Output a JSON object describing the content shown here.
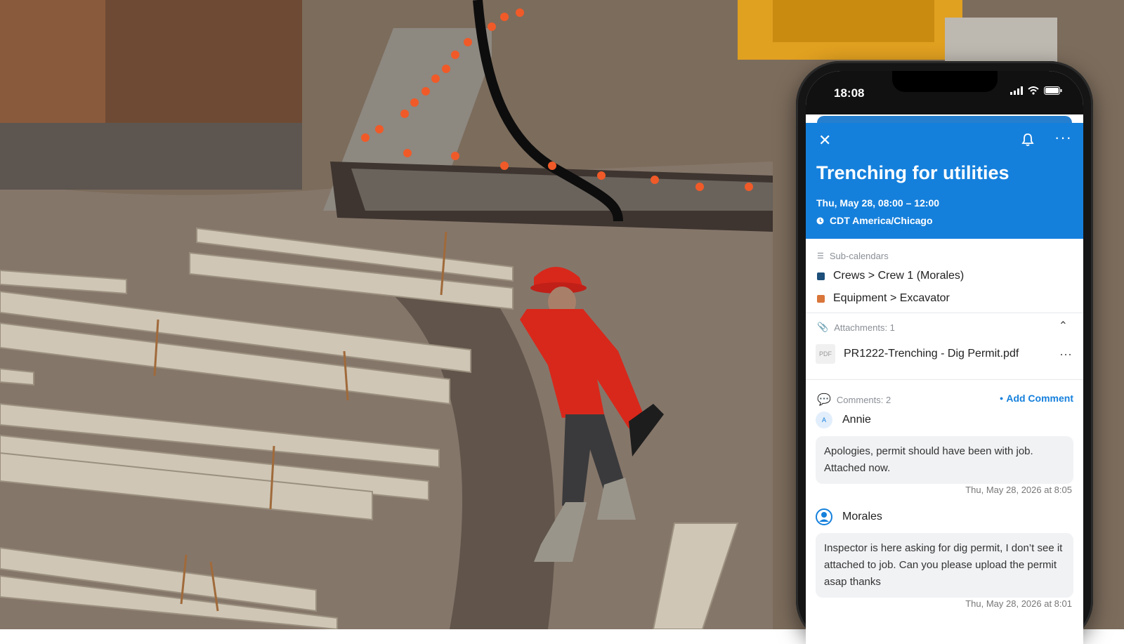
{
  "phone": {
    "status_time": "18:08",
    "header": {
      "title": "Trenching for utilities",
      "when": "Thu, May 28, 08:00 – 12:00",
      "timezone": "CDT America/Chicago",
      "close_icon": "close-icon",
      "bell_icon": "bell-icon",
      "more_icon": "more-icon"
    },
    "subcalendars": {
      "label": "Sub-calendars",
      "items": [
        {
          "label": "Crews > Crew 1 (Morales)",
          "color": "#1d4f7a"
        },
        {
          "label": "Equipment > Excavator",
          "color": "#d9763a"
        }
      ]
    },
    "attachments": {
      "label": "Attachments: 1",
      "files": [
        {
          "badge": "PDF",
          "name": "PR1222-Trenching - Dig Permit.pdf"
        }
      ]
    },
    "comments": {
      "label": "Comments: 2",
      "add_label": "Add Comment",
      "items": [
        {
          "author": "Annie",
          "initial": "A",
          "text": "Apologies, permit should have been with job. Attached now.",
          "stamp": "Thu, May 28, 2026 at  8:05"
        },
        {
          "author": "Morales",
          "text": "Inspector is here asking for dig permit, I don’t see it attached to job. Can you please upload the permit asap thanks",
          "stamp": "Thu, May 28, 2026 at  8:01"
        }
      ]
    }
  },
  "colors": {
    "accent": "#1580dc",
    "worker_hoodie": "#d8281b"
  }
}
